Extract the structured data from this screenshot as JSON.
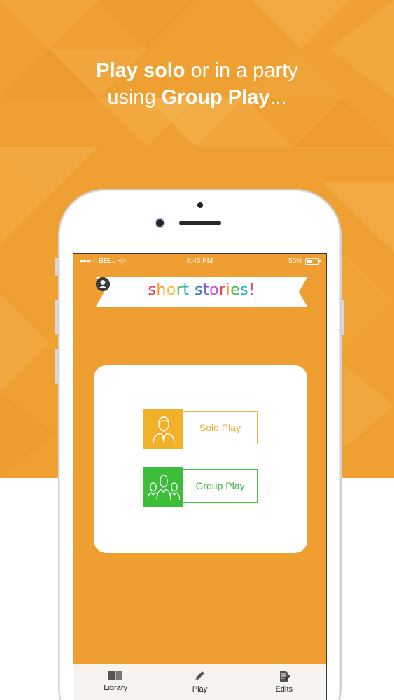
{
  "headline": {
    "line1_bold": "Play solo",
    "line1_rest": " or in a party",
    "line2_prefix": "using ",
    "line2_bold": "Group Play",
    "line2_suffix": "..."
  },
  "status_bar": {
    "carrier": "BELL",
    "time": "8:43 PM",
    "battery_text": "50%",
    "battery_level": 0.5
  },
  "banner": {
    "title_letters": [
      "s",
      "h",
      "o",
      "r",
      "t",
      " ",
      "s",
      "t",
      "o",
      "r",
      "i",
      "e",
      "s",
      "!"
    ],
    "title_colors": [
      "#E8384F",
      "#F29A2E",
      "#F2C230",
      "#3DBE3A",
      "#1BB3C9",
      "#000000",
      "#2E6FD6",
      "#7B5BD6",
      "#C44FD0",
      "#E8384F",
      "#F29A2E",
      "#3DBE3A",
      "#1BB3C9",
      "#E8384F"
    ],
    "left_icon": "gear-icon",
    "right_icon": "user-icon"
  },
  "modes": {
    "solo": {
      "label": "Solo Play",
      "icon": "single-person-icon",
      "color": "#F2B12A"
    },
    "group": {
      "label": "Group Play",
      "icon": "group-people-icon",
      "color": "#3DBE3A"
    }
  },
  "tabs": [
    {
      "label": "Library",
      "icon": "book-icon"
    },
    {
      "label": "Play",
      "icon": "pencil-icon"
    },
    {
      "label": "Edits",
      "icon": "edit-document-icon"
    }
  ],
  "colors": {
    "background_orange": "#EFA033",
    "screen_orange": "#EF9E31"
  }
}
